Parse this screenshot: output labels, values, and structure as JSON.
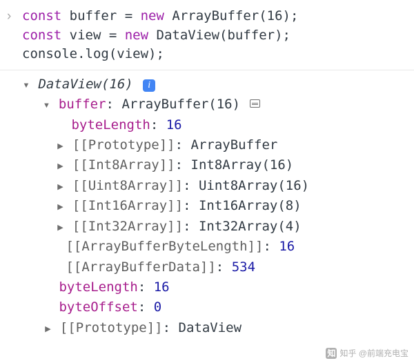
{
  "code": {
    "line1_kw1": "const",
    "line1_var": " buffer ",
    "line1_op": "= ",
    "line1_kw2": "new",
    "line1_cls": " ArrayBuffer",
    "line1_arg": "(16);",
    "line2_kw1": "const",
    "line2_var": " view ",
    "line2_op": "= ",
    "line2_kw2": "new",
    "line2_cls": " DataView",
    "line2_arg": "(buffer);",
    "line3": "console.log(view);"
  },
  "result": {
    "root": "DataView(16)",
    "buffer_key": "buffer",
    "buffer_val": "ArrayBuffer(16)",
    "buffer_byteLength_key": "byteLength",
    "buffer_byteLength_val": "16",
    "proto_key": "[[Prototype]]",
    "proto_val_ab": "ArrayBuffer",
    "int8_key": "[[Int8Array]]",
    "int8_val": "Int8Array(16)",
    "uint8_key": "[[Uint8Array]]",
    "uint8_val": "Uint8Array(16)",
    "int16_key": "[[Int16Array]]",
    "int16_val": "Int16Array(8)",
    "int32_key": "[[Int32Array]]",
    "int32_val": "Int32Array(4)",
    "abbl_key": "[[ArrayBufferByteLength]]",
    "abbl_val": "16",
    "abd_key": "[[ArrayBufferData]]",
    "abd_val": "534",
    "byteLength_key": "byteLength",
    "byteLength_val": "16",
    "byteOffset_key": "byteOffset",
    "byteOffset_val": "0",
    "proto_val_dv": "DataView"
  },
  "watermark": "知乎 @前端充电宝"
}
